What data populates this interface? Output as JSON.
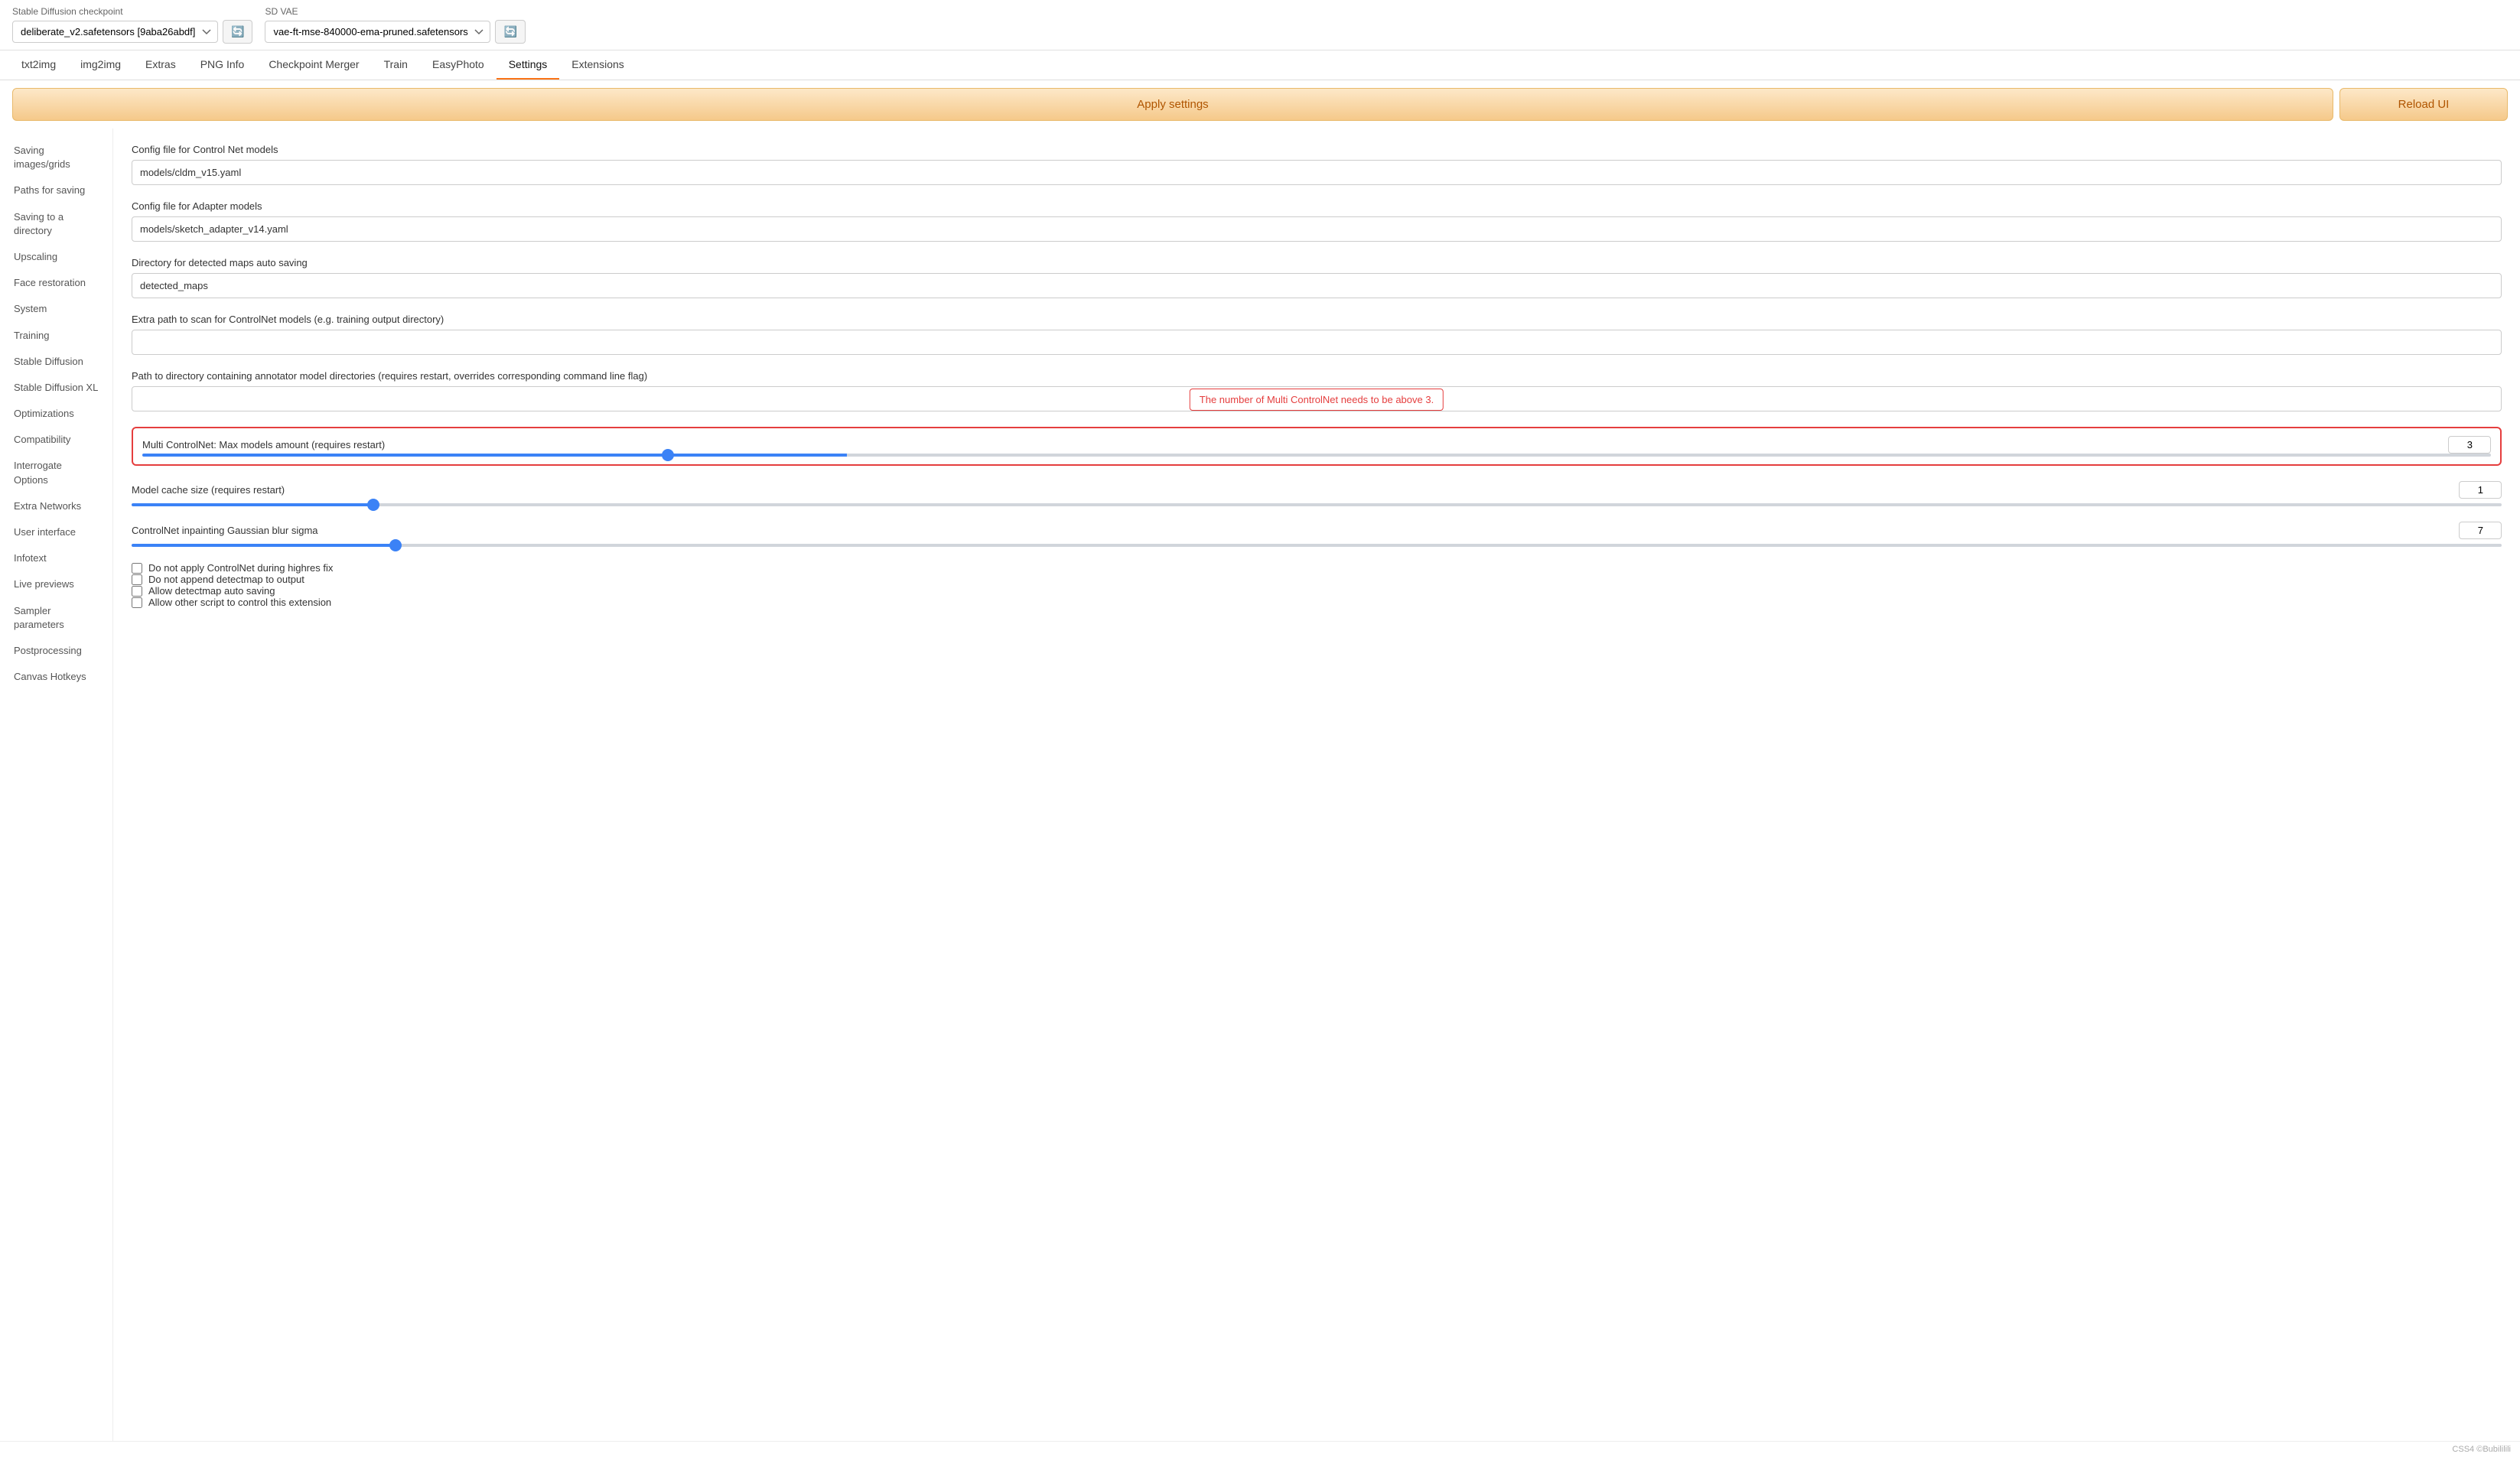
{
  "topbar": {
    "checkpoint_label": "Stable Diffusion checkpoint",
    "checkpoint_value": "deliberate_v2.safetensors [9aba26abdf]",
    "vae_label": "SD VAE",
    "vae_value": "vae-ft-mse-840000-ema-pruned.safetensors"
  },
  "nav": {
    "tabs": [
      {
        "id": "txt2img",
        "label": "txt2img"
      },
      {
        "id": "img2img",
        "label": "img2img"
      },
      {
        "id": "extras",
        "label": "Extras"
      },
      {
        "id": "png_info",
        "label": "PNG Info"
      },
      {
        "id": "checkpoint_merger",
        "label": "Checkpoint Merger"
      },
      {
        "id": "train",
        "label": "Train"
      },
      {
        "id": "easyphoto",
        "label": "EasyPhoto"
      },
      {
        "id": "settings",
        "label": "Settings"
      },
      {
        "id": "extensions",
        "label": "Extensions"
      }
    ],
    "active": "settings"
  },
  "actions": {
    "apply_label": "Apply settings",
    "reload_label": "Reload UI"
  },
  "sidebar": {
    "items": [
      {
        "id": "saving_images",
        "label": "Saving images/grids"
      },
      {
        "id": "paths_saving",
        "label": "Paths for saving"
      },
      {
        "id": "saving_directory",
        "label": "Saving to a directory"
      },
      {
        "id": "upscaling",
        "label": "Upscaling"
      },
      {
        "id": "face_restoration",
        "label": "Face restoration"
      },
      {
        "id": "system",
        "label": "System"
      },
      {
        "id": "training",
        "label": "Training"
      },
      {
        "id": "stable_diffusion",
        "label": "Stable Diffusion"
      },
      {
        "id": "stable_diffusion_xl",
        "label": "Stable Diffusion XL"
      },
      {
        "id": "optimizations",
        "label": "Optimizations"
      },
      {
        "id": "compatibility",
        "label": "Compatibility"
      },
      {
        "id": "interrogate_options",
        "label": "Interrogate Options"
      },
      {
        "id": "extra_networks",
        "label": "Extra Networks"
      },
      {
        "id": "user_interface",
        "label": "User interface"
      },
      {
        "id": "infotext",
        "label": "Infotext"
      },
      {
        "id": "live_previews",
        "label": "Live previews"
      },
      {
        "id": "sampler_parameters",
        "label": "Sampler parameters"
      },
      {
        "id": "postprocessing",
        "label": "Postprocessing"
      },
      {
        "id": "canvas_hotkeys",
        "label": "Canvas Hotkeys"
      }
    ]
  },
  "settings": {
    "controlnet_config": {
      "label": "Config file for Control Net models",
      "value": "models/cldm_v15.yaml"
    },
    "adapter_config": {
      "label": "Config file for Adapter models",
      "value": "models/sketch_adapter_v14.yaml"
    },
    "detected_maps_dir": {
      "label": "Directory for detected maps auto saving",
      "value": "detected_maps"
    },
    "extra_path": {
      "label": "Extra path to scan for ControlNet models (e.g. training output directory)",
      "value": ""
    },
    "annotator_dir": {
      "label": "Path to directory containing annotator model directories (requires restart, overrides corresponding command line flag)",
      "value": ""
    },
    "error_msg": "The number of Multi ControlNet needs to be above 3.",
    "multi_controlnet": {
      "label": "Multi ControlNet: Max models amount (requires restart)",
      "value": 3,
      "min": 1,
      "max": 10,
      "step": 1,
      "position": 30
    },
    "model_cache": {
      "label": "Model cache size (requires restart)",
      "value": 1,
      "min": 0,
      "max": 10,
      "step": 1,
      "position": 0
    },
    "gaussian_blur": {
      "label": "ControlNet inpainting Gaussian blur sigma",
      "value": 7,
      "min": 0,
      "max": 64,
      "step": 1,
      "position": 11
    },
    "checkboxes": [
      {
        "id": "no_controlnet_hires",
        "label": "Do not apply ControlNet during highres fix",
        "checked": false
      },
      {
        "id": "no_append_detectmap",
        "label": "Do not append detectmap to output",
        "checked": false
      },
      {
        "id": "allow_detectmap_autosave",
        "label": "Allow detectmap auto saving",
        "checked": false
      },
      {
        "id": "allow_other_script",
        "label": "Allow other script to control this extension",
        "checked": false
      }
    ]
  },
  "footer": {
    "text": "CSS4 ©Bubililili"
  }
}
